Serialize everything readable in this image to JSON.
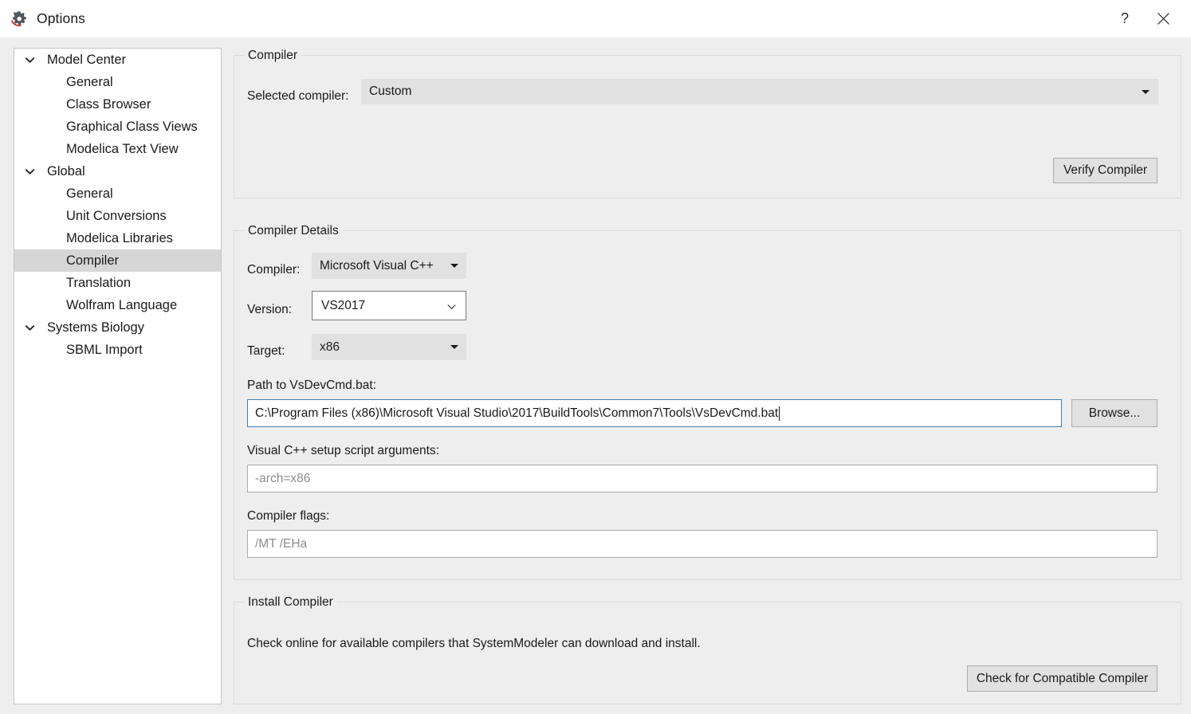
{
  "window": {
    "title": "Options",
    "app_icon": "gear-icon",
    "help_label": "?",
    "close_label": "✕"
  },
  "sidebar": {
    "items": [
      {
        "label": "Model Center",
        "level": "root",
        "expanded": true,
        "selected": false,
        "icon": "chevron-down-icon"
      },
      {
        "label": "General",
        "level": "child",
        "expanded": false,
        "selected": false,
        "icon": ""
      },
      {
        "label": "Class Browser",
        "level": "child",
        "expanded": false,
        "selected": false,
        "icon": ""
      },
      {
        "label": "Graphical Class Views",
        "level": "child",
        "expanded": false,
        "selected": false,
        "icon": ""
      },
      {
        "label": "Modelica Text View",
        "level": "child",
        "expanded": false,
        "selected": false,
        "icon": ""
      },
      {
        "label": "Global",
        "level": "root",
        "expanded": true,
        "selected": false,
        "icon": "chevron-down-icon"
      },
      {
        "label": "General",
        "level": "child",
        "expanded": false,
        "selected": false,
        "icon": ""
      },
      {
        "label": "Unit Conversions",
        "level": "child",
        "expanded": false,
        "selected": false,
        "icon": ""
      },
      {
        "label": "Modelica Libraries",
        "level": "child",
        "expanded": false,
        "selected": false,
        "icon": ""
      },
      {
        "label": "Compiler",
        "level": "child",
        "expanded": false,
        "selected": true,
        "icon": ""
      },
      {
        "label": "Translation",
        "level": "child",
        "expanded": false,
        "selected": false,
        "icon": ""
      },
      {
        "label": "Wolfram Language",
        "level": "child",
        "expanded": false,
        "selected": false,
        "icon": ""
      },
      {
        "label": "Systems Biology",
        "level": "root",
        "expanded": true,
        "selected": false,
        "icon": "chevron-down-icon"
      },
      {
        "label": "SBML Import",
        "level": "child",
        "expanded": false,
        "selected": false,
        "icon": ""
      }
    ]
  },
  "compiler_group": {
    "legend": "Compiler",
    "selected_compiler_label": "Selected compiler:",
    "selected_compiler_value": "Custom",
    "verify_button": "Verify Compiler"
  },
  "compiler_details_group": {
    "legend": "Compiler Details",
    "compiler_label": "Compiler:",
    "compiler_value": "Microsoft Visual C++",
    "version_label": "Version:",
    "version_value": "VS2017",
    "target_label": "Target:",
    "target_value": "x86",
    "path_label": "Path to VsDevCmd.bat:",
    "path_value": "C:\\Program Files (x86)\\Microsoft Visual Studio\\2017\\BuildTools\\Common7\\Tools\\VsDevCmd.bat",
    "browse_button": "Browse...",
    "setup_args_label": "Visual C++ setup script arguments:",
    "setup_args_placeholder": "-arch=x86",
    "setup_args_value": "",
    "compiler_flags_label": "Compiler flags:",
    "compiler_flags_placeholder": "/MT /EHa",
    "compiler_flags_value": ""
  },
  "install_group": {
    "legend": "Install Compiler",
    "description": "Check online for available compilers that SystemModeler can download and install.",
    "check_button": "Check for Compatible Compiler"
  },
  "colors": {
    "dialog_bg": "#eeeeee",
    "panel_bg": "#ffffff",
    "selection": "#d6d6d6",
    "control_bg": "#e1e1e1",
    "focus_border": "#3f7fb5",
    "accent_red": "#c8332b"
  }
}
